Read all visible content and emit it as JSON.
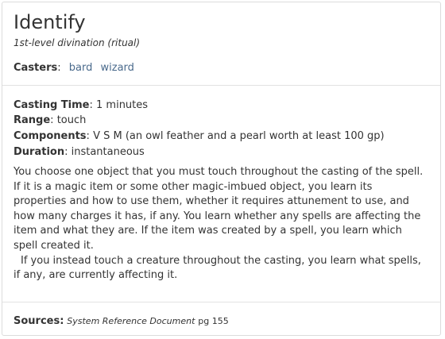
{
  "spell": {
    "name": "Identify",
    "school_line": "1st-level divination (ritual)",
    "casters_label": "Casters",
    "casters": [
      "bard",
      "wizard"
    ]
  },
  "stats": {
    "casting_time_label": "Casting Time",
    "casting_time": "1 minutes",
    "range_label": "Range",
    "range": "touch",
    "components_label": "Components",
    "components": "V S M (an owl feather and a pearl worth at least 100 gp)",
    "duration_label": "Duration",
    "duration": "instantaneous"
  },
  "description": {
    "p1": "You choose one object that you must touch throughout the casting of the spell. If it is a magic item or some other magic-imbued object, you learn its properties and how to use them, whether it requires attunement to use, and how many charges it has, if any. You learn whether any spells are affecting the item and what they are. If the item was created by a spell, you learn which spell created it.",
    "p2": "If you instead touch a creature throughout the casting, you learn what spells, if any, are currently affecting it."
  },
  "sources": {
    "label": "Sources",
    "book": "System Reference Document",
    "page": "pg 155"
  }
}
